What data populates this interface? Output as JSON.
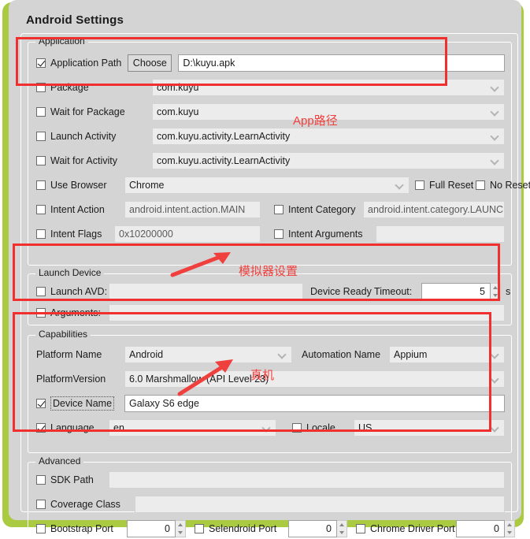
{
  "window": {
    "title": "Android Settings",
    "accent_green": "#aacb41",
    "panel_bg": "#d4d4d4",
    "annotation_red": "#f0302e"
  },
  "groups": {
    "application": {
      "label": "Application",
      "rows": {
        "application_path": {
          "checkbox_label": "Application Path",
          "checked": true,
          "button": "Choose",
          "value": "D:\\kuyu.apk"
        },
        "package": {
          "checkbox_label": "Package",
          "checked": false,
          "value": "com.kuyu"
        },
        "wait_for_package": {
          "checkbox_label": "Wait for Package",
          "checked": false,
          "value": "com.kuyu"
        },
        "launch_activity": {
          "checkbox_label": "Launch Activity",
          "checked": false,
          "value": "com.kuyu.activity.LearnActivity"
        },
        "wait_for_activity": {
          "checkbox_label": "Wait for Activity",
          "checked": false,
          "value": "com.kuyu.activity.LearnActivity"
        },
        "use_browser": {
          "checkbox_label": "Use Browser",
          "checked": false,
          "value": "Chrome"
        },
        "full_reset": {
          "checkbox_label": "Full Reset",
          "checked": false
        },
        "no_reset": {
          "checkbox_label": "No Reset",
          "checked": false
        },
        "intent_action": {
          "checkbox_label": "Intent Action",
          "checked": false,
          "value": "android.intent.action.MAIN"
        },
        "intent_category": {
          "checkbox_label": "Intent Category",
          "checked": false,
          "value": "android.intent.category.LAUNCHER"
        },
        "intent_flags": {
          "checkbox_label": "Intent Flags",
          "checked": false,
          "value": "0x10200000"
        },
        "intent_arguments": {
          "checkbox_label": "Intent Arguments",
          "checked": false,
          "value": ""
        }
      }
    },
    "launch_device": {
      "label": "Launch Device",
      "rows": {
        "launch_avd": {
          "checkbox_label": "Launch AVD:",
          "checked": false,
          "value": ""
        },
        "device_ready_timeout": {
          "label": "Device Ready Timeout:",
          "value": "5",
          "unit": "s"
        },
        "arguments": {
          "checkbox_label": "Arguments:",
          "checked": false,
          "value": ""
        }
      }
    },
    "capabilities": {
      "label": "Capabilities",
      "rows": {
        "platform_name": {
          "label": "Platform Name",
          "value": "Android"
        },
        "automation_name": {
          "label": "Automation Name",
          "value": "Appium"
        },
        "platform_version": {
          "label": "PlatformVersion",
          "value": "6.0 Marshmallow (API Level 23)"
        },
        "device_name": {
          "checkbox_label": "Device Name",
          "checked": true,
          "value": "Galaxy S6 edge"
        },
        "language": {
          "checkbox_label": "Language",
          "checked": true,
          "value": "en"
        },
        "locale": {
          "checkbox_label": "Locale",
          "checked": false,
          "value": "US"
        }
      }
    },
    "advanced": {
      "label": "Advanced",
      "rows": {
        "sdk_path": {
          "checkbox_label": "SDK Path",
          "checked": false,
          "value": ""
        },
        "coverage_class": {
          "checkbox_label": "Coverage Class",
          "checked": false,
          "value": ""
        },
        "bootstrap_port": {
          "checkbox_label": "Bootstrap Port",
          "checked": false,
          "value": "0"
        },
        "selendroid_port": {
          "checkbox_label": "Selendroid Port",
          "checked": false,
          "value": "0"
        },
        "chrome_driver_port": {
          "checkbox_label": "Chrome Driver Port",
          "checked": false,
          "value": "0"
        }
      }
    }
  },
  "annotations": {
    "app_path_note": "App路径",
    "emulator_note": "模拟器设置",
    "real_device_note": "真机"
  }
}
